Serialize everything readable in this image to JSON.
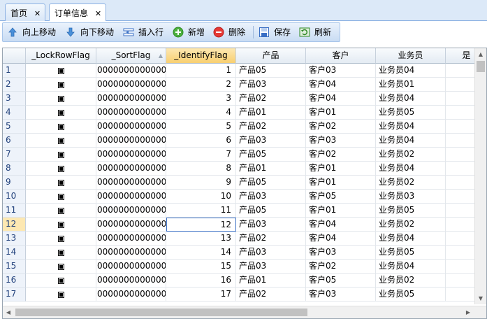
{
  "tabs": [
    {
      "label": "首页",
      "close": "✕"
    },
    {
      "label": "订单信息",
      "close": "✕"
    }
  ],
  "toolbar": {
    "move_up": "向上移动",
    "move_down": "向下移动",
    "insert_row": "插入行",
    "add": "新增",
    "delete": "删除",
    "save": "保存",
    "refresh": "刷新"
  },
  "grid": {
    "columns": [
      "_LockRowFlag",
      "_SortFlag",
      "_IdentifyFlag",
      "产品",
      "客户",
      "业务员",
      "是"
    ],
    "sort_flag_text": "0000000000000",
    "rows": [
      {
        "n": "1",
        "id": "1",
        "product": "产品05",
        "customer": "客户03",
        "sales": "业务员04"
      },
      {
        "n": "2",
        "id": "2",
        "product": "产品03",
        "customer": "客户04",
        "sales": "业务员01"
      },
      {
        "n": "3",
        "id": "3",
        "product": "产品02",
        "customer": "客户04",
        "sales": "业务员04"
      },
      {
        "n": "4",
        "id": "4",
        "product": "产品01",
        "customer": "客户01",
        "sales": "业务员05"
      },
      {
        "n": "5",
        "id": "5",
        "product": "产品02",
        "customer": "客户02",
        "sales": "业务员04"
      },
      {
        "n": "6",
        "id": "6",
        "product": "产品03",
        "customer": "客户03",
        "sales": "业务员04"
      },
      {
        "n": "7",
        "id": "7",
        "product": "产品05",
        "customer": "客户02",
        "sales": "业务员02"
      },
      {
        "n": "8",
        "id": "8",
        "product": "产品01",
        "customer": "客户01",
        "sales": "业务员04"
      },
      {
        "n": "9",
        "id": "9",
        "product": "产品05",
        "customer": "客户01",
        "sales": "业务员02"
      },
      {
        "n": "10",
        "id": "10",
        "product": "产品03",
        "customer": "客户05",
        "sales": "业务员03"
      },
      {
        "n": "11",
        "id": "11",
        "product": "产品05",
        "customer": "客户01",
        "sales": "业务员05"
      },
      {
        "n": "12",
        "id": "12",
        "product": "产品03",
        "customer": "客户04",
        "sales": "业务员02"
      },
      {
        "n": "13",
        "id": "13",
        "product": "产品02",
        "customer": "客户04",
        "sales": "业务员04"
      },
      {
        "n": "14",
        "id": "14",
        "product": "产品03",
        "customer": "客户03",
        "sales": "业务员05"
      },
      {
        "n": "15",
        "id": "15",
        "product": "产品03",
        "customer": "客户02",
        "sales": "业务员04"
      },
      {
        "n": "16",
        "id": "16",
        "product": "产品01",
        "customer": "客户05",
        "sales": "业务员02"
      },
      {
        "n": "17",
        "id": "17",
        "product": "产品02",
        "customer": "客户03",
        "sales": "业务员05"
      }
    ],
    "current_row": "12"
  },
  "colors": {
    "tab_strip": "#dce9f8",
    "selected_header": "#f8cf70",
    "row_header_text": "#1f3f7a"
  },
  "icons": [
    "arrow-up-icon",
    "arrow-down-icon",
    "insert-row-icon",
    "add-icon",
    "delete-icon",
    "save-icon",
    "refresh-icon"
  ]
}
